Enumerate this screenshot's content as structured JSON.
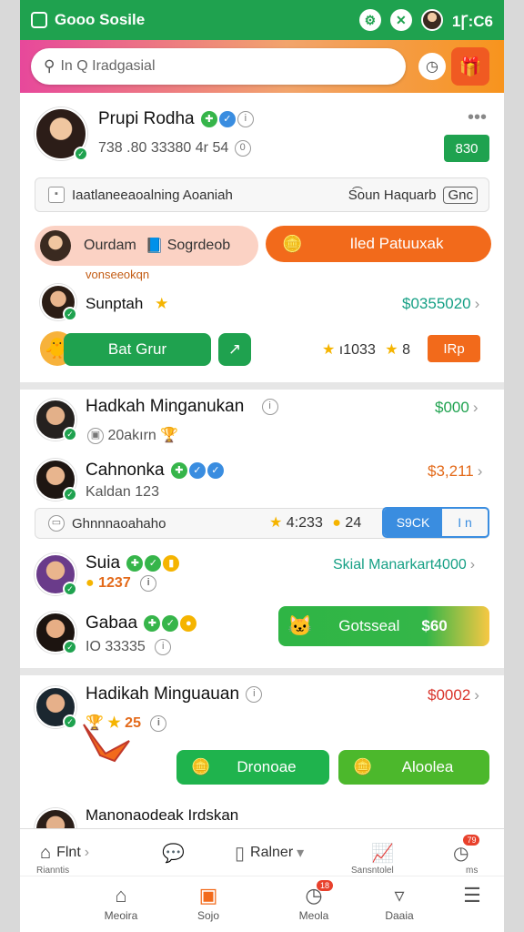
{
  "status_bar": {
    "title": "Gooo Sosile",
    "time": "1Ꞅ:C6"
  },
  "search": {
    "placeholder": "In Q  Iradgasial"
  },
  "profile": {
    "name": "Prupi Rodha",
    "stats": "738 .80 33380 4r  54",
    "action_label": "830",
    "pill_left": "Iaatlaneeaoalning Aoaniah",
    "pill_right": "S͡oun Haquarb",
    "pill_button": "Gnc"
  },
  "promo": {
    "left_label": "Ourdam",
    "left_label2": "Sogrdeob",
    "right_label": "Iled Patuuxak",
    "subtitle": "vonseeokqn"
  },
  "sunptah": {
    "name": "Sunptah",
    "amount": "$0355020"
  },
  "actions": {
    "primary": "Bat Grur",
    "stat1": "ı1033",
    "stat2": "8",
    "secondary": "IRp"
  },
  "list": [
    {
      "name": "Hadkah Minganukan",
      "sub": "20akırn",
      "amount": "$000",
      "amount_color": "g"
    },
    {
      "name": "Cahnonka",
      "sub": "Kaldan 123",
      "amount": "$3,211",
      "amount_color": "o"
    }
  ],
  "filter": {
    "label": "Ghnnnaoahaho",
    "stat1": "4:233",
    "stat2": "24",
    "btn_left": "S9CK",
    "btn_right": "I n"
  },
  "suia": {
    "name": "Suia",
    "sub": "1237",
    "amount": "Skial Manarkart4000"
  },
  "gabaa": {
    "name": "Gabaa",
    "sub": "IO 33335",
    "button": "Gotsseal",
    "button_amount": "$60"
  },
  "hadikah2": {
    "name": "Hadikah Minguauan",
    "sub": "25",
    "amount": "$0002",
    "btn1": "Dronoae",
    "btn2": "Aloolea"
  },
  "last": {
    "name": "Manonaodeak  Irdskan"
  },
  "tabbar": [
    {
      "label": "Flnt",
      "sub": "Rianntis"
    },
    {
      "label": ""
    },
    {
      "label": "Ralner"
    },
    {
      "label": "",
      "sub": "Sansntolel"
    },
    {
      "label": "",
      "sub": "ms",
      "badge": "79"
    }
  ],
  "nav": [
    {
      "label": "Meoira",
      "icon": "home-icon"
    },
    {
      "label": "Sojo",
      "icon": "shop-icon"
    },
    {
      "label": "Meola",
      "icon": "clock-icon",
      "badge": "18"
    },
    {
      "label": "Daaia",
      "icon": "download-icon"
    },
    {
      "label": "",
      "icon": "menu-icon"
    }
  ]
}
